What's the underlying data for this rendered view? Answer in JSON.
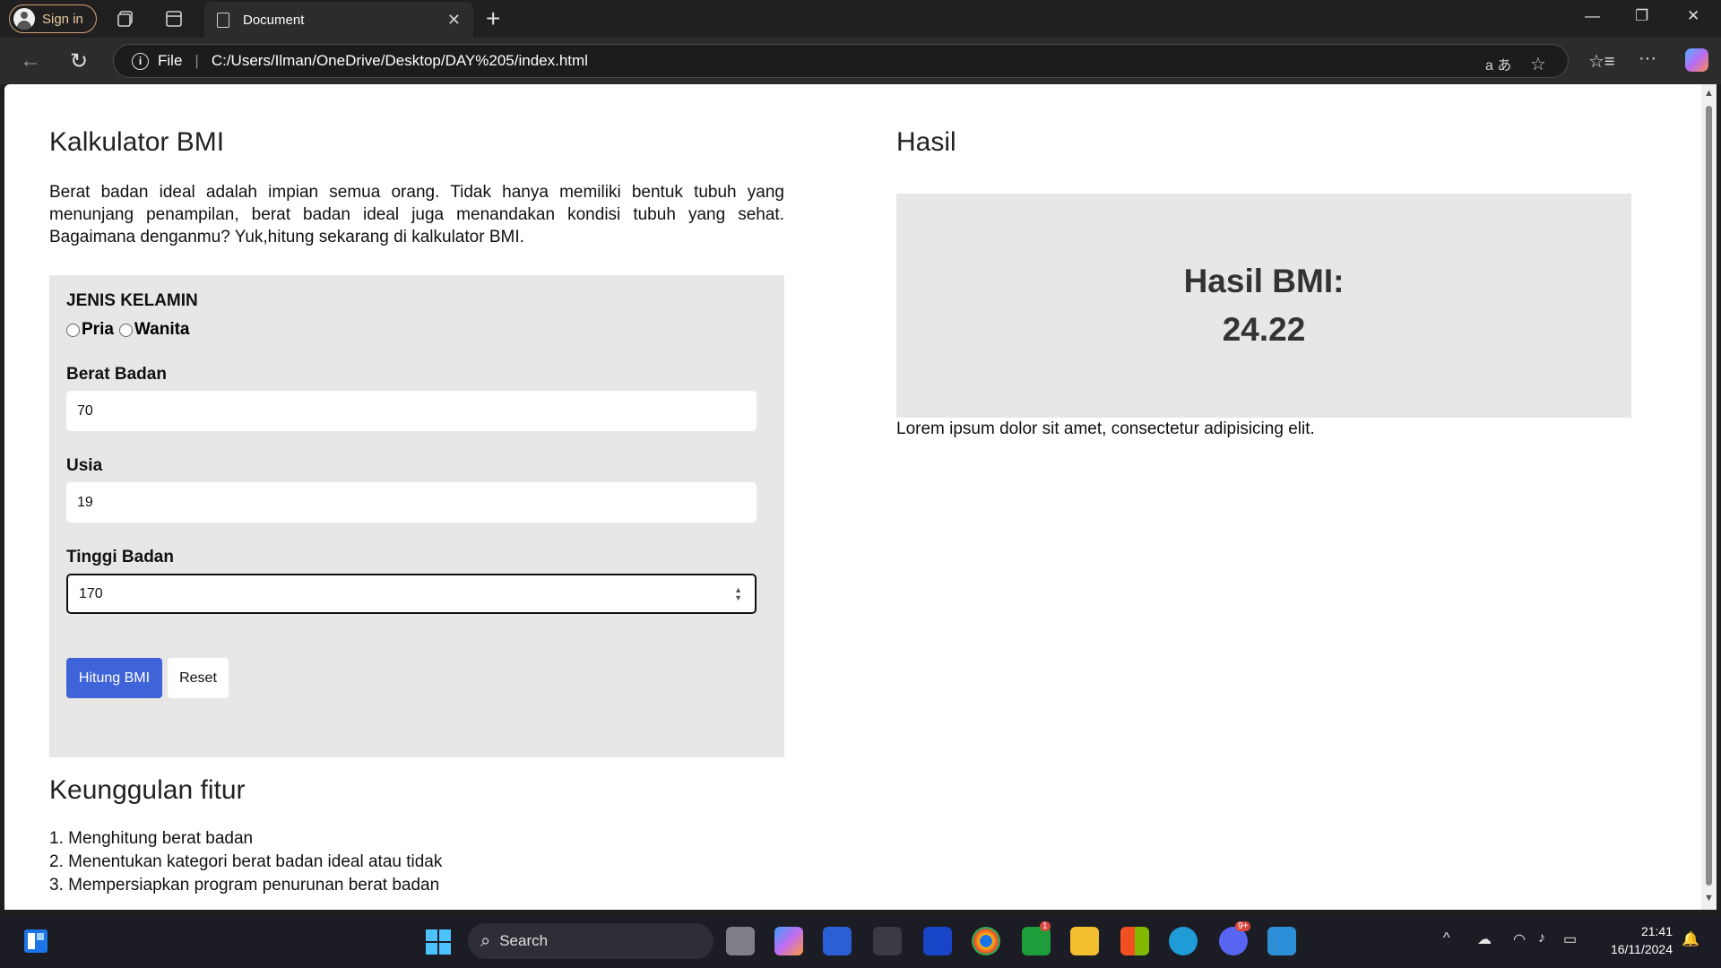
{
  "browser": {
    "signin_label": "Sign in",
    "tab_title": "Document",
    "url_scheme_label": "File",
    "url": "C:/Users/Ilman/OneDrive/Desktop/DAY%205/index.html"
  },
  "page": {
    "title": "Kalkulator BMI",
    "intro": "Berat badan ideal adalah impian semua orang. Tidak hanya memiliki bentuk tubuh yang menunjang penampilan, berat badan ideal juga menandakan kondisi tubuh yang sehat. Bagaimana denganmu? Yuk,hitung sekarang di kalkulator BMI.",
    "form": {
      "gender_label": "JENIS KELAMIN",
      "gender_options": [
        "Pria",
        "Wanita"
      ],
      "weight_label": "Berat Badan",
      "weight_value": "70",
      "age_label": "Usia",
      "age_value": "19",
      "height_label": "Tinggi Badan",
      "height_value": "170",
      "calc_button": "Hitung BMI",
      "reset_button": "Reset"
    },
    "features": {
      "title": "Keunggulan fitur",
      "items": [
        "1. Menghitung berat badan",
        "2. Menentukan kategori berat badan ideal atau tidak",
        "3. Mempersiapkan program penurunan berat badan"
      ]
    },
    "result": {
      "title": "Hasil",
      "box_label": "Hasil BMI:",
      "bmi_value": "24.22",
      "description": "Lorem ipsum dolor sit amet, consectetur adipisicing elit."
    }
  },
  "taskbar": {
    "search_label": "Search",
    "time": "21:41",
    "date": "16/11/2024",
    "xbox_badge": "1",
    "discord_badge": "9+"
  },
  "colors": {
    "primary_button": "#3f64d9",
    "panel_bg": "#e8e7e5"
  }
}
